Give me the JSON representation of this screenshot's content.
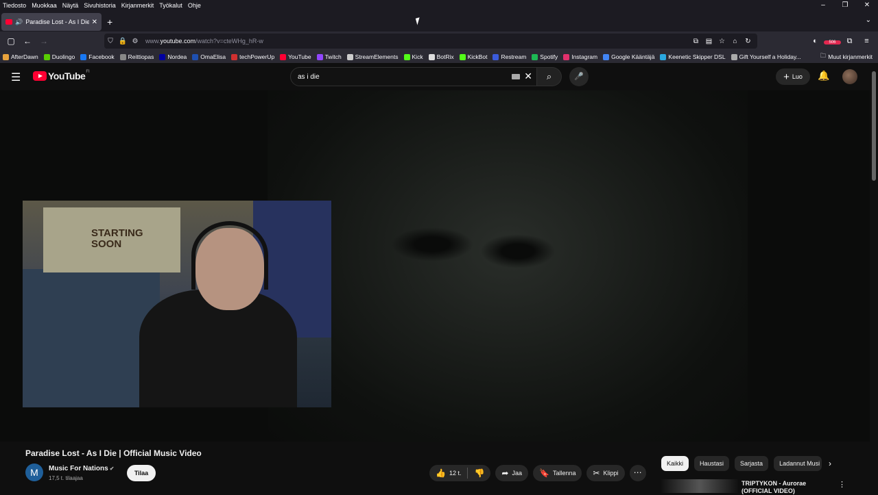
{
  "menubar": {
    "items": [
      "Tiedosto",
      "Muokkaa",
      "Näytä",
      "Sivuhistoria",
      "Kirjanmerkit",
      "Työkalut",
      "Ohje"
    ]
  },
  "tab": {
    "title": "Paradise Lost - As I Die | Offi"
  },
  "url": {
    "prefix": "www.",
    "host": "youtube.com",
    "path": "/watch?v=cteWHg_hR-w"
  },
  "ext_badge": "506",
  "bookmarks": [
    {
      "label": "AfterDawn",
      "color": "#e8a33d"
    },
    {
      "label": "Duolingo",
      "color": "#58cc02"
    },
    {
      "label": "Facebook",
      "color": "#1877f2"
    },
    {
      "label": "Reittiopas",
      "color": "#888888"
    },
    {
      "label": "Nordea",
      "color": "#0000a0"
    },
    {
      "label": "OmaElisa",
      "color": "#1e4fb0"
    },
    {
      "label": "techPowerUp",
      "color": "#d03030"
    },
    {
      "label": "YouTube",
      "color": "#ff0033"
    },
    {
      "label": "Twitch",
      "color": "#9146ff"
    },
    {
      "label": "StreamElements",
      "color": "#cccccc"
    },
    {
      "label": "Kick",
      "color": "#53fc18"
    },
    {
      "label": "BotRix",
      "color": "#dddddd"
    },
    {
      "label": "KickBot",
      "color": "#53fc18"
    },
    {
      "label": "Restream",
      "color": "#3b5bdb"
    },
    {
      "label": "Spotify",
      "color": "#1db954"
    },
    {
      "label": "Instagram",
      "color": "#e1306c"
    },
    {
      "label": "Google Kääntäjä",
      "color": "#4285f4"
    },
    {
      "label": "Keenetic Skipper DSL",
      "color": "#2aa8e0"
    },
    {
      "label": "Gift Yourself a Holiday...",
      "color": "#aaaaaa"
    }
  ],
  "bookmarks_other": "Muut kirjanmerkit",
  "youtube": {
    "logo_text": "YouTube",
    "region": "FI",
    "search_value": "as i die",
    "create_label": "Luo"
  },
  "webcam": {
    "poster_text": "STARTING SOON"
  },
  "video": {
    "title": "Paradise Lost - As I Die | Official Music Video",
    "channel_initial": "M",
    "channel": "Music For Nations",
    "subscribers": "17,5 t. tilaajaa",
    "subscribe_label": "Tilaa",
    "likes": "12 t.",
    "share_label": "Jaa",
    "save_label": "Tallenna",
    "clip_label": "Klippi"
  },
  "chips": [
    "Kaikki",
    "Haustasi",
    "Sarjasta",
    "Ladannut Musi"
  ],
  "recommendation": {
    "title_line1": "TRIPTYKON - Aurorae",
    "title_line2": "(OFFICIAL VIDEO)"
  }
}
